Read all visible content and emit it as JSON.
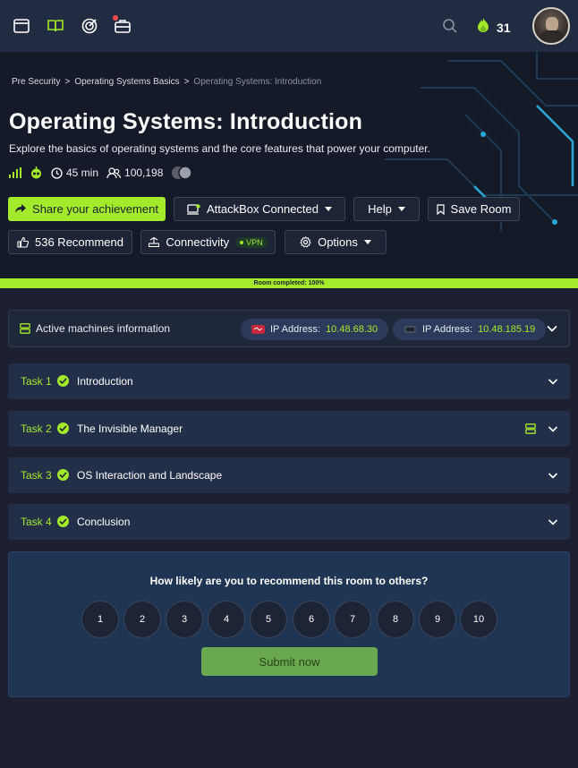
{
  "nav": {
    "streak_count": "31",
    "icons": [
      "window-icon",
      "book-icon",
      "target-icon",
      "toolbox-icon",
      "search-icon",
      "flame-icon"
    ]
  },
  "breadcrumb": {
    "items": [
      "Pre Security",
      "Operating Systems Basics",
      "Operating Systems: Introduction"
    ],
    "separator": ">"
  },
  "room": {
    "title": "Operating Systems: Introduction",
    "description": "Explore the basics of operating systems and the core features that power your computer.",
    "duration": "45 min",
    "users": "100,198"
  },
  "actions": {
    "share": "Share your achievement",
    "attackbox": "AttackBox Connected",
    "help": "Help",
    "save": "Save Room",
    "recommend": "536 Recommend",
    "connectivity": "Connectivity",
    "vpn": "VPN",
    "options": "Options"
  },
  "progress": {
    "label": "Room completed: 100%",
    "percent": 100
  },
  "machines": {
    "title": "Active machines information",
    "ip_label": "IP Address:",
    "ips": [
      "10.48.68.30",
      "10.48.185.19"
    ]
  },
  "tasks": [
    {
      "num": "Task 1",
      "name": "Introduction"
    },
    {
      "num": "Task 2",
      "name": "The Invisible Manager"
    },
    {
      "num": "Task 3",
      "name": "OS Interaction and Landscape"
    },
    {
      "num": "Task 4",
      "name": "Conclusion"
    }
  ],
  "recommend_box": {
    "question": "How likely are you to recommend this room to others?",
    "scale": [
      "1",
      "2",
      "3",
      "4",
      "5",
      "6",
      "7",
      "8",
      "9",
      "10"
    ],
    "submit": "Submit now"
  },
  "colors": {
    "accent": "#a3ea2a",
    "nav_bg": "#212c42",
    "page_bg": "#1c2030",
    "task_bg": "#232f49"
  }
}
